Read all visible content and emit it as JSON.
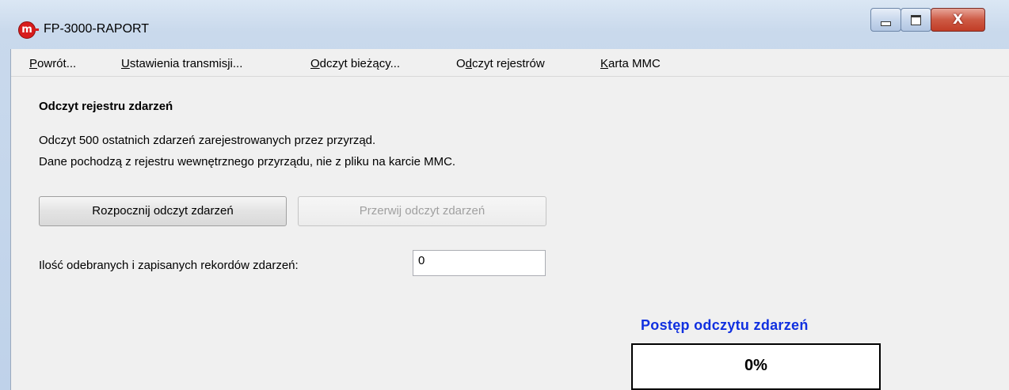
{
  "window": {
    "title": "FP-3000-RAPORT",
    "icon": "app-logo-icon",
    "controls": {
      "minimize": "minimize-icon",
      "maximize": "maximize-icon",
      "close_glyph": "X"
    }
  },
  "menu": {
    "items": [
      {
        "accel": "P",
        "rest": "owrót..."
      },
      {
        "accel": "U",
        "rest": "stawienia transmisji..."
      },
      {
        "accel": "O",
        "rest": "dczyt bieżący..."
      },
      {
        "pre": "O",
        "accel": "d",
        "rest": "czyt rejestrów"
      },
      {
        "accel": "K",
        "rest": "arta MMC"
      }
    ]
  },
  "main": {
    "heading": "Odczyt rejestru zdarzeń",
    "description_line1": "Odczyt 500 ostatnich zdarzeń zarejestrowanych przez przyrząd.",
    "description_line2": "Dane pochodzą z rejestru wewnętrznego przyrządu, nie z pliku na karcie MMC.",
    "start_button": "Rozpocznij odczyt zdarzeń",
    "stop_button": "Przerwij odczyt zdarzeń",
    "count_label": "Ilość odebranych i zapisanych rekordów zdarzeń:",
    "count_value": "0",
    "progress_title": "Postęp odczytu zdarzeń",
    "progress_text": "0%",
    "progress_fraction": 0
  },
  "colors": {
    "progress_title": "#1030e0",
    "close_button": "#c13d27"
  }
}
